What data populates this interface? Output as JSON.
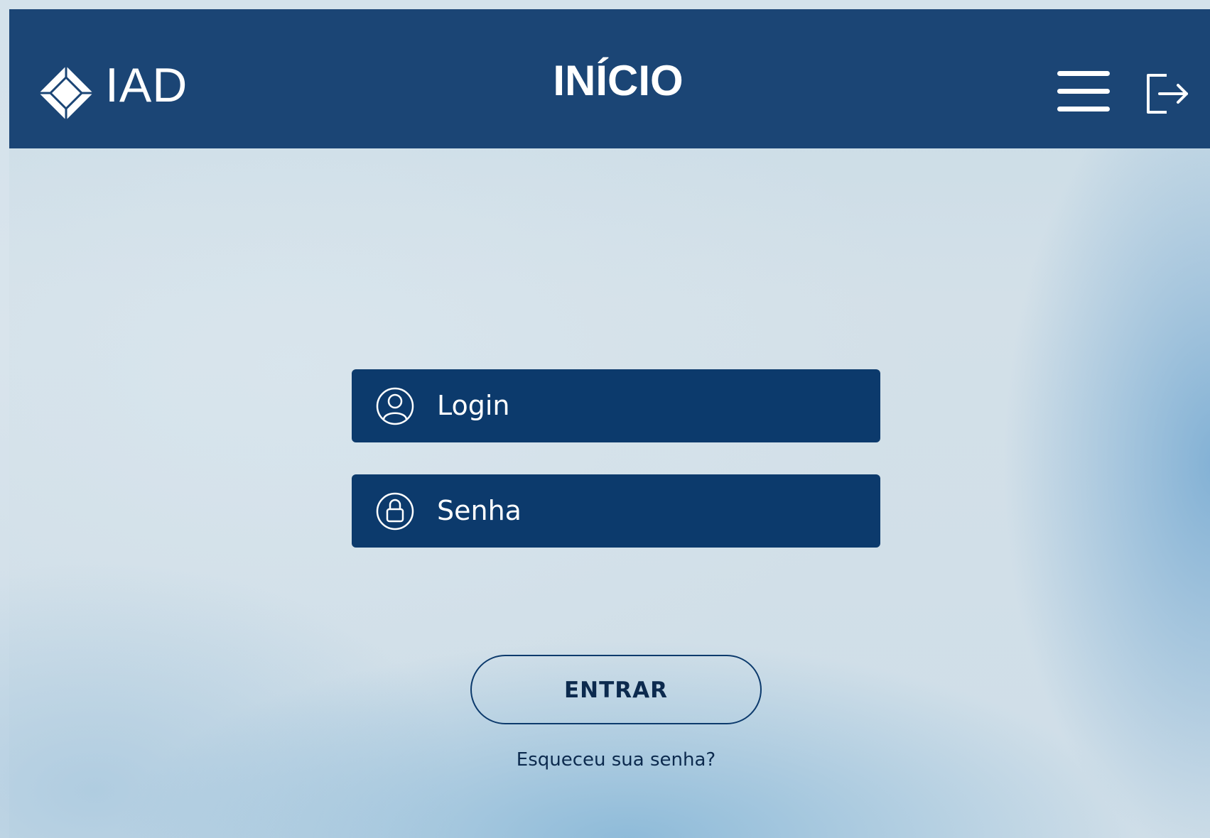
{
  "header": {
    "brand": "IAD",
    "title": "INÍCIO",
    "logo_icon": "diamond-logo-icon",
    "menu_icon": "hamburger-menu-icon",
    "logout_icon": "logout-icon",
    "background_color": "#1b4575"
  },
  "login_form": {
    "login_field": {
      "placeholder": "Login",
      "value": "",
      "icon": "user-icon"
    },
    "password_field": {
      "placeholder": "Senha",
      "value": "",
      "icon": "lock-icon"
    },
    "submit_label": "ENTRAR",
    "forgot_password_label": "Esqueceu sua senha?",
    "field_color": "#0c3a6c"
  }
}
